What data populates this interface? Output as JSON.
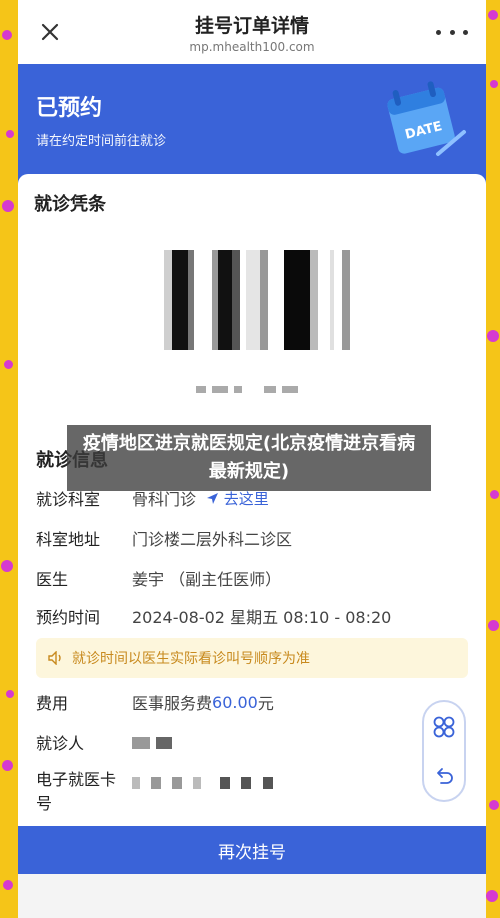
{
  "header": {
    "title": "挂号订单详情",
    "subtitle": "mp.mhealth100.com"
  },
  "banner": {
    "status": "已预约",
    "hint": "请在约定时间前往就诊",
    "calendar_text": "DATE"
  },
  "voucher": {
    "title": "就诊凭条"
  },
  "info": {
    "title": "就诊信息",
    "rows": [
      {
        "key": "就诊科室",
        "value": "骨科门诊",
        "action": "去这里"
      },
      {
        "key": "科室地址",
        "value": "门诊楼二层外科二诊区"
      },
      {
        "key": "医生",
        "value": "姜宇 （副主任医师）"
      },
      {
        "key": "预约时间",
        "value": "2024-08-02 星期五 08:10 - 08:20"
      }
    ],
    "notice": "就诊时间以医生实际看诊叫号顺序为准",
    "fee_key": "费用",
    "fee_label": "医事服务费",
    "fee_amount": "60.00",
    "fee_unit": "元",
    "patient_key": "就诊人",
    "card_key_line1": "电子就医卡",
    "card_key_line2": "号"
  },
  "rebook_button": "再次挂号",
  "overlay_text": "疫情地区进京就医规定(北京疫情进京看病最新规定)",
  "colors": {
    "accent": "#3a63d8",
    "frame": "#f5c518",
    "notice_bg": "#fdf6dc"
  }
}
